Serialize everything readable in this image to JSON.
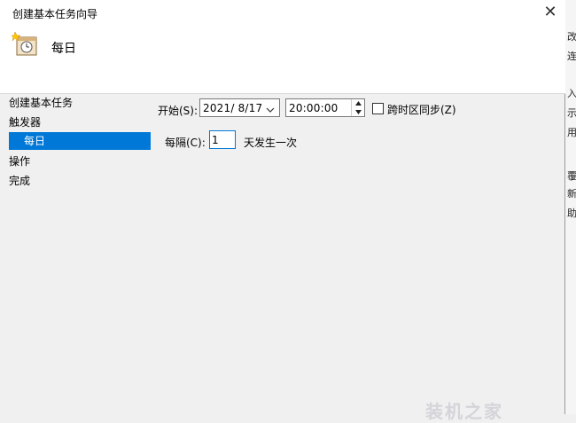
{
  "window": {
    "title": "创建基本任务向导"
  },
  "header": {
    "title": "每日",
    "icon": "task-scheduler-icon"
  },
  "sidebar": {
    "items": [
      {
        "label": "创建基本任务"
      },
      {
        "label": "触发器"
      },
      {
        "label": "每日",
        "selected": true
      },
      {
        "label": "操作"
      },
      {
        "label": "完成"
      }
    ]
  },
  "form": {
    "start_label": "开始(S):",
    "start_date": "2021/  8/17",
    "start_time": "20:00:00",
    "sync_tz_label": "跨时区同步(Z)",
    "sync_tz_checked": false,
    "every_label": "每隔(C):",
    "every_value": "1",
    "every_suffix": "天发生一次"
  },
  "background_window": {
    "fragments": [
      "改",
      "连",
      "入",
      "示",
      "用",
      "覆",
      "新",
      "助"
    ]
  },
  "watermark": {
    "text": "装机之家"
  },
  "colors": {
    "selection": "#0078d7",
    "background": "#f0f0f0"
  }
}
